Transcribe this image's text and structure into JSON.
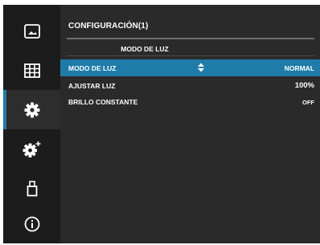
{
  "header": {
    "title": "CONFIGURACIÓN(1)",
    "section": "MODO DE LUZ"
  },
  "sidebar": {
    "items": [
      {
        "icon": "image-icon",
        "active": false
      },
      {
        "icon": "grid-icon",
        "active": false
      },
      {
        "icon": "gear-icon",
        "active": true
      },
      {
        "icon": "gear-plus-icon",
        "active": false
      },
      {
        "icon": "usb-icon",
        "active": false
      },
      {
        "icon": "info-icon",
        "active": false
      }
    ]
  },
  "settings": [
    {
      "label": "MODO DE LUZ",
      "value": "NORMAL",
      "selected": true
    },
    {
      "label": "AJUSTAR LUZ",
      "value": "100%",
      "selected": false
    },
    {
      "label": "BRILLO CONSTANTE",
      "value": "OFF",
      "selected": false
    }
  ],
  "colors": {
    "accent": "#1f7ca8",
    "background": "#2a2a2a",
    "sidebar": "#1c1c1c"
  }
}
